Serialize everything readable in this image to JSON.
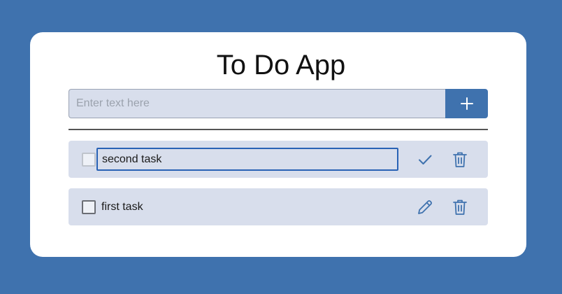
{
  "app": {
    "title": "To Do App"
  },
  "new_task": {
    "placeholder": "Enter text here",
    "value": "",
    "add_icon": "plus-icon"
  },
  "tasks": [
    {
      "text": "second task",
      "editing": true,
      "checked": false,
      "actions": [
        "check-icon",
        "trash-icon"
      ]
    },
    {
      "text": "first task",
      "editing": false,
      "checked": false,
      "actions": [
        "pencil-icon",
        "trash-icon"
      ]
    }
  ],
  "colors": {
    "background": "#3f72ae",
    "accent": "#3f72ae",
    "row_background": "#d8deec",
    "focus_border": "#2962b5"
  }
}
